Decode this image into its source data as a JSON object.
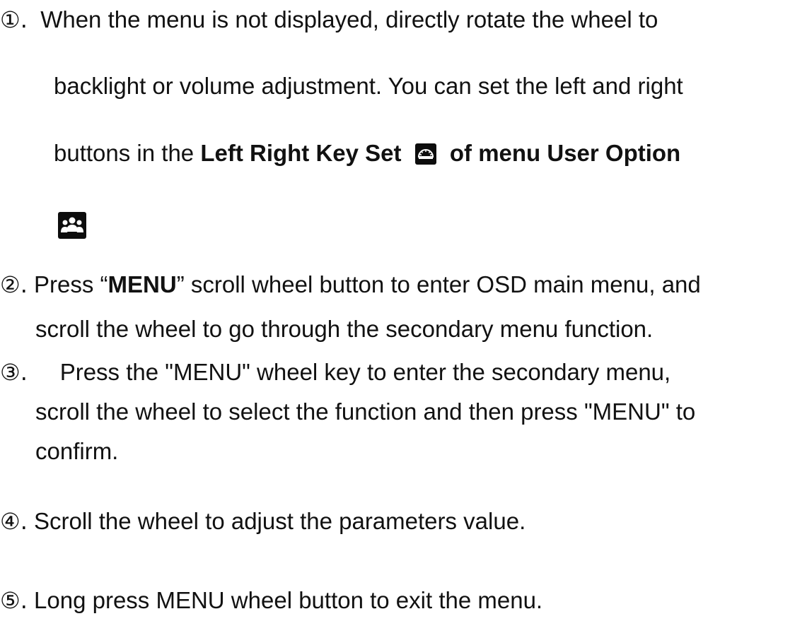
{
  "steps": [
    {
      "marker": "①.",
      "lines": [
        "When the menu is not displayed, directly rotate the wheel to",
        "backlight or volume adjustment. You can set the left and right"
      ],
      "line3_prefix": "buttons in the ",
      "line3_bold_1": "Left Right Key Set",
      "line3_bold_2": "of menu User Option"
    },
    {
      "marker": "②.",
      "line1_prefix": "Press “",
      "line1_bold": "MENU",
      "line1_suffix": "” scroll wheel button to enter OSD main menu, and",
      "line2": "scroll the wheel to go through the secondary menu function."
    },
    {
      "marker": "③.",
      "line1": "Press the \"MENU\" wheel key to enter the secondary menu,",
      "line2": "scroll the wheel to select the function and then press \"MENU\" to",
      "line3": "confirm."
    },
    {
      "marker": "④.",
      "line1": "Scroll the wheel to adjust the parameters value."
    },
    {
      "marker": "⑤.",
      "line1": "Long press MENU wheel button to exit the menu."
    }
  ],
  "icons": {
    "left_right_key_set": "dial-gauge-icon",
    "user_option": "users-group-icon"
  }
}
